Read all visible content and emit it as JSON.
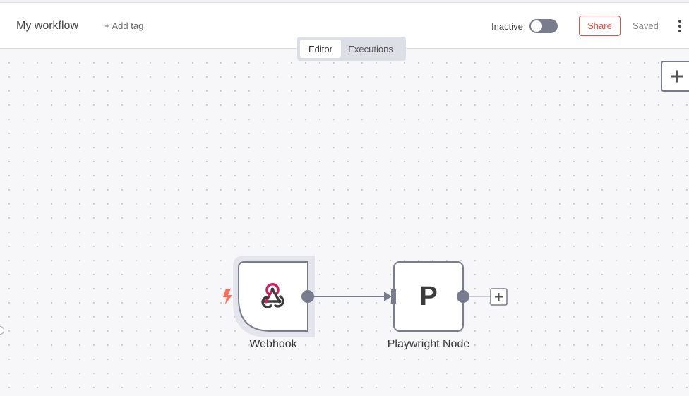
{
  "header": {
    "workflow_name": "My workflow",
    "add_tag_label": "+ Add tag",
    "status_label": "Inactive",
    "share_label": "Share",
    "saved_label": "Saved"
  },
  "mode_switch": {
    "tabs": [
      {
        "label": "Editor",
        "active": true
      },
      {
        "label": "Executions",
        "active": false
      }
    ]
  },
  "nodes": [
    {
      "label": "Webhook",
      "icon": "webhook-icon",
      "trigger_icon": "lightning-bolt-icon",
      "trigger_color": "#ff6d5a",
      "selected": true
    },
    {
      "label": "Playwright Node",
      "icon_text": "P"
    }
  ],
  "colors": {
    "accent": "#ea4b42",
    "node_border": "#787c8c",
    "canvas_bg": "#f7f7fa",
    "webhook_pink": "#c91f5f",
    "webhook_dark": "#3b3b3b"
  }
}
